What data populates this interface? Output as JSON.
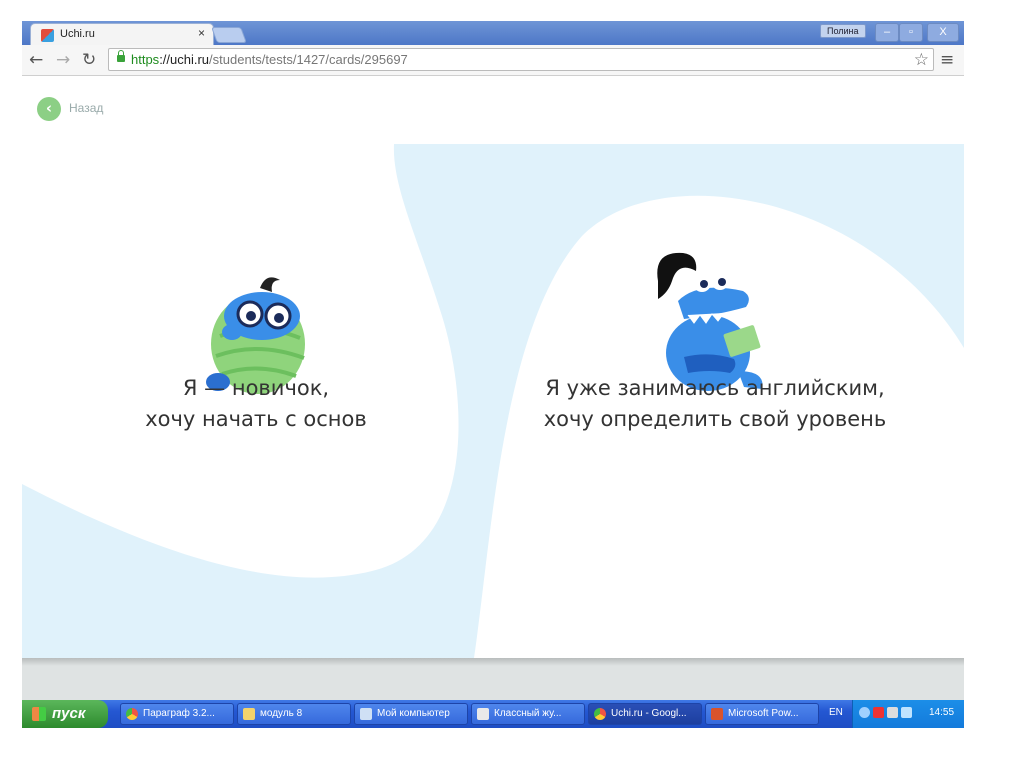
{
  "browser": {
    "tab_title": "Uchi.ru",
    "tab_close": "×",
    "user_name": "Полина",
    "window_controls": [
      "–",
      "▫",
      "X"
    ],
    "url_scheme": "https",
    "url_host": "://uchi.ru",
    "url_path": "/students/tests/1427/cards/295697"
  },
  "page": {
    "back_label": "Назад",
    "options": [
      {
        "line1": "Я — новичок,",
        "line2": "хочу начать с основ"
      },
      {
        "line1": "Я уже занимаюсь английским,",
        "line2": "хочу определить свой уровень"
      }
    ],
    "colors": {
      "wave": "#e0f2fb",
      "back": "#8ccf85",
      "mascot_green": "#8fd47c",
      "mascot_blue": "#3a8ee8"
    }
  },
  "taskbar": {
    "start_label": "пуск",
    "items": [
      {
        "label": "Параграф 3.2...",
        "icon": "chrome-icon"
      },
      {
        "label": "модуль 8",
        "icon": "folder-icon"
      },
      {
        "label": "Мой компьютер",
        "icon": "computer-icon"
      },
      {
        "label": "Классный жу...",
        "icon": "journal-icon"
      },
      {
        "label": "Uchi.ru - Googl...",
        "icon": "chrome-icon"
      },
      {
        "label": "Microsoft Pow...",
        "icon": "powerpoint-icon"
      }
    ],
    "lang": "EN",
    "clock": "14:55"
  }
}
